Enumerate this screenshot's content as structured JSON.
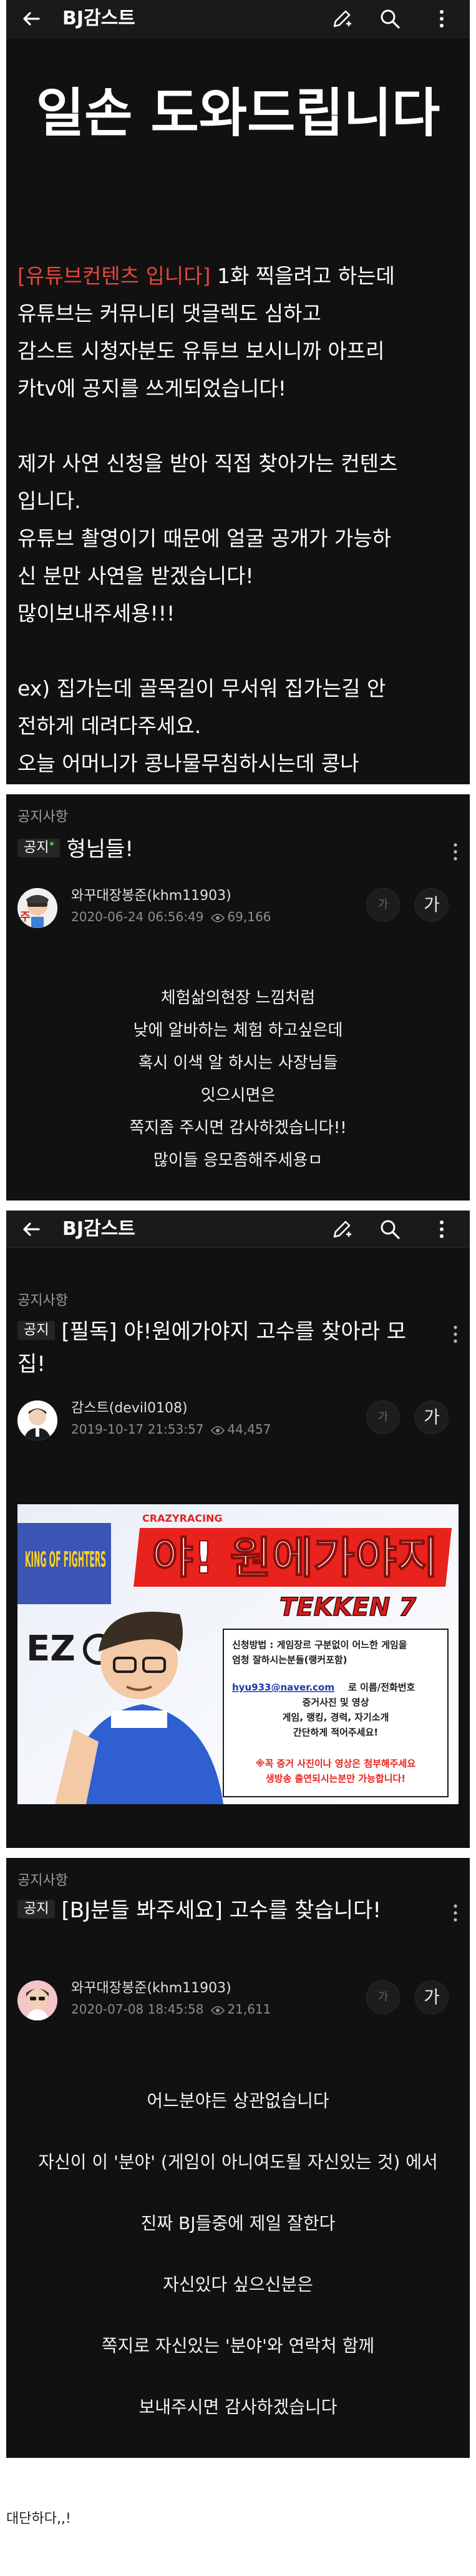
{
  "app": {
    "board_title": "BJ감스트"
  },
  "post1": {
    "headline": "일손 도와드립니다",
    "paragraph_lines": [
      {
        "red": "[유튜브컨텐츠 입니다]",
        "text": " 1화 찍을려고 하는데"
      },
      {
        "red": "",
        "text": "유튜브는 커뮤니티 댓글렉도 심하고"
      },
      {
        "red": "",
        "text": "감스트 시청자분도 유튜브 보시니까 아프리"
      },
      {
        "red": "",
        "text": "카tv에 공지를 쓰게되었습니다!"
      },
      {
        "red": "",
        "text": ""
      },
      {
        "red": "",
        "text": "제가 사연 신청을 받아 직접 찾아가는 컨텐츠"
      },
      {
        "red": "",
        "text": "입니다."
      },
      {
        "red": "",
        "text": "유튜브 촬영이기 때문에 얼굴 공개가 가능하"
      },
      {
        "red": "",
        "text": "신 분만 사연을 받겠습니다!"
      },
      {
        "red": "",
        "text": "많이보내주세용!!!"
      },
      {
        "red": "",
        "text": ""
      },
      {
        "red": "",
        "text": "ex) 집가는데 골목길이 무서워 집가는길 안"
      },
      {
        "red": "",
        "text": "전하게 데려다주세요."
      },
      {
        "red": "",
        "text": "  오늘 어머니가 콩나물무침하시는데 콩나"
      }
    ]
  },
  "post2": {
    "section_label": "공지사항",
    "badge": "공지",
    "title": "형님들!",
    "author": "와꾸대장봉준(khm11903)",
    "date": "2020-06-24 06:56:49",
    "views": "69,166",
    "font_small": "가",
    "font_large": "가",
    "lines": [
      "체험삶의현장 느낌처럼",
      "낮에 알바하는 체험 하고싶은데",
      "혹시 이색 알 하시는 사장님들",
      "잇으시면은",
      "쪽지좀 주시면 감사하겠습니다!!",
      "많이들 응모좀해주세용ㅁ"
    ]
  },
  "post3": {
    "section_label": "공지사항",
    "badge": "공지",
    "title": "[필독] 야!원에가야지 고수를 찾아라 모집!",
    "author": "감스트(devil0108)",
    "date": "2019-10-17 21:53:57",
    "views": "44,457",
    "font_small": "가",
    "font_large": "가",
    "banner": {
      "top_text": "CRAZYRACING",
      "headline": "야! 원에가야지",
      "logo_text": "TEKKEN 7",
      "left_logo": "EZ",
      "left_brand": "KING OF FIGHTERS",
      "info_lines": [
        "신청방법 : 게임장르 구분없이 어느한 게임을",
        "엄청 잘하시는분들(랭커포함)",
        "",
        "로 이름/전화번호",
        "증거사진 및 영상",
        "게임, 랭킹, 경력, 자기소개",
        "간단하게 적어주세요!"
      ],
      "email": "hyu933@naver.com",
      "warning_lines": [
        "※꼭 증거 사진이나 영상은 첨부해주세요",
        "생방송 출연되시는분만 가능합니다!"
      ],
      "colors": {
        "red": "#e8231d",
        "blue": "#1c3aa8"
      }
    }
  },
  "post4": {
    "section_label": "공지사항",
    "badge": "공지",
    "title": "[BJ분들 봐주세요] 고수를 찾습니다!",
    "author": "와꾸대장봉준(khm11903)",
    "date": "2020-07-08 18:45:58",
    "views": "21,611",
    "font_small": "가",
    "font_large": "가",
    "lines": [
      "어느분야든 상관없습니다",
      "자신이 이 '분야' (게임이 아니여도될 자신있는 것) 에서",
      "진짜 BJ들중에 제일 잘한다",
      "자신있다 싶으신분은",
      "쪽지로 자신있는 '분야'와 연락처 함께",
      "보내주시면 감사하겠습니다"
    ]
  },
  "caption": "대단하다,,!",
  "colors": {
    "background": "#111111",
    "accent_red": "#e8453c",
    "notice_green": "#3db74e"
  }
}
